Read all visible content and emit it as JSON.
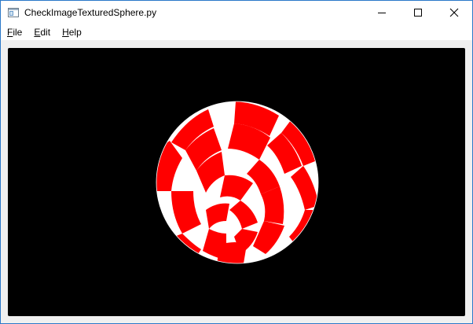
{
  "window": {
    "title": "CheckImageTexturedSphere.py",
    "app_icon": "window-app-icon",
    "controls": [
      "minimize-icon",
      "maximize-icon",
      "close-icon"
    ]
  },
  "menu": {
    "items": [
      {
        "label": "File",
        "mnemonic": "F"
      },
      {
        "label": "Edit",
        "mnemonic": "E"
      },
      {
        "label": "Help",
        "mnemonic": "H"
      }
    ]
  },
  "scene": {
    "background": "#000000",
    "object": "checker-textured-sphere",
    "colors": {
      "primary": "#ff0000",
      "secondary": "#ffffff"
    }
  }
}
